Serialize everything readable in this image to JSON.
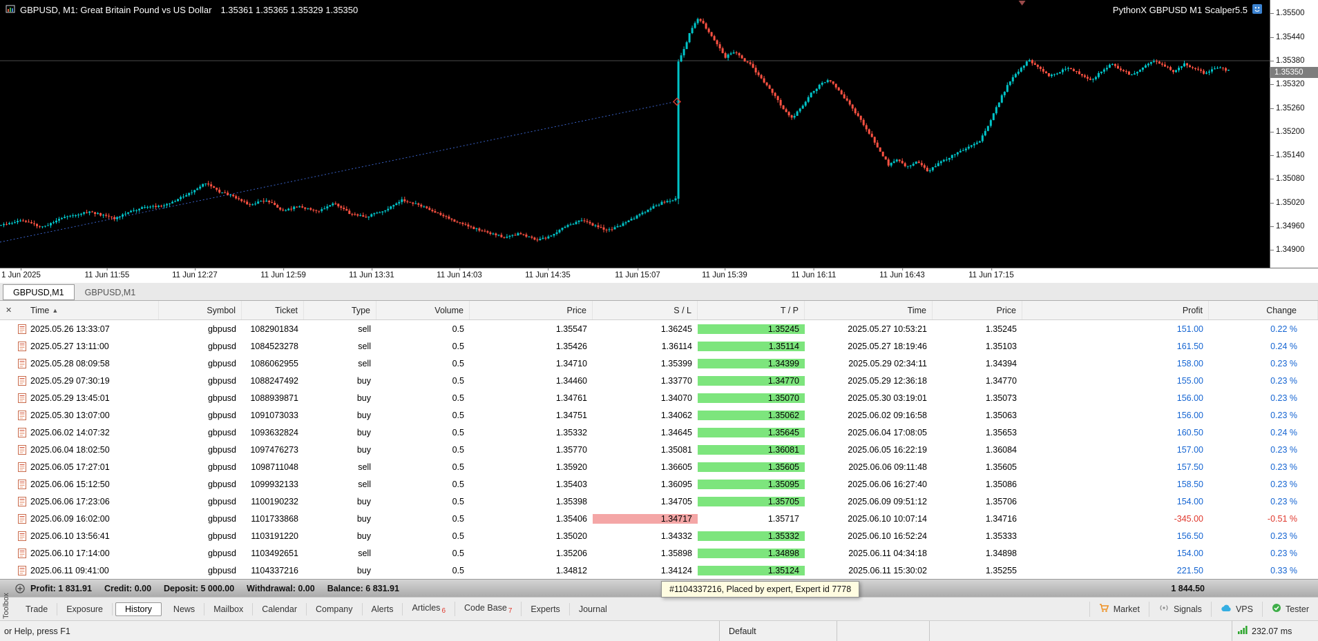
{
  "chart": {
    "title": "GBPUSD, M1:  Great Britain Pound vs US Dollar",
    "ohlc": "1.35361 1.35365 1.35329 1.35350",
    "expert_name": "PythonX GBPUSD M1 Scalper5.5",
    "current_price": "1.35350",
    "colors": {
      "background": "#000000",
      "up": "#00c4c8",
      "down": "#ff5242",
      "trendline": "#3a62c8",
      "hline": "#4a4a4a",
      "badge_bg": "#7d7d7d"
    },
    "chart_data": {
      "type": "candlestick",
      "symbol": "GBPUSD",
      "timeframe": "M1",
      "price_axis_labels": [
        "1.35500",
        "1.35440",
        "1.35380",
        "1.35320",
        "1.35260",
        "1.35200",
        "1.35140",
        "1.35080",
        "1.35020",
        "1.34960",
        "1.34900"
      ],
      "time_axis_labels": [
        {
          "label": "1 Jun 2025",
          "f": 0.0,
          "align": "left"
        },
        {
          "label": "11 Jun 11:55",
          "f": 0.0843
        },
        {
          "label": "11 Jun 12:27",
          "f": 0.1534
        },
        {
          "label": "11 Jun 12:59",
          "f": 0.2231
        },
        {
          "label": "11 Jun 13:31",
          "f": 0.2927
        },
        {
          "label": "11 Jun 14:03",
          "f": 0.3618
        },
        {
          "label": "11 Jun 14:35",
          "f": 0.4314
        },
        {
          "label": "11 Jun 15:07",
          "f": 0.5022
        },
        {
          "label": "11 Jun 15:39",
          "f": 0.5707
        },
        {
          "label": "11 Jun 16:11",
          "f": 0.6409
        },
        {
          "label": "11 Jun 16:43",
          "f": 0.7105
        },
        {
          "label": "11 Jun 17:15",
          "f": 0.7807
        }
      ],
      "price_top": 1.35534,
      "price_bottom": 1.34855,
      "candle_count": 445,
      "noise": 5e-05,
      "wick": 7e-05,
      "seed": 1234567,
      "spike": {
        "t": 0.5515,
        "open": 1.3503,
        "close": 1.35378,
        "low": 1.35016,
        "high": 1.35384
      },
      "trendline": {
        "t1": 0.0,
        "p1": 1.3492,
        "t2": 0.5515,
        "p2": 1.35277
      },
      "marker": {
        "t": 0.5515,
        "p": 1.35276
      },
      "hline_price": 1.3538,
      "shift_marker_f": 0.805,
      "anchors": [
        [
          0.0,
          1.34962
        ],
        [
          0.017,
          1.34976
        ],
        [
          0.034,
          1.34958
        ],
        [
          0.051,
          1.34984
        ],
        [
          0.072,
          1.34997
        ],
        [
          0.092,
          1.3498
        ],
        [
          0.113,
          1.35006
        ],
        [
          0.134,
          1.35014
        ],
        [
          0.152,
          1.3504
        ],
        [
          0.166,
          1.3507
        ],
        [
          0.177,
          1.35048
        ],
        [
          0.19,
          1.35036
        ],
        [
          0.202,
          1.35014
        ],
        [
          0.216,
          1.35027
        ],
        [
          0.229,
          1.35001
        ],
        [
          0.243,
          1.3501
        ],
        [
          0.257,
          1.34997
        ],
        [
          0.271,
          1.35018
        ],
        [
          0.284,
          1.34993
        ],
        [
          0.298,
          1.34984
        ],
        [
          0.312,
          1.35001
        ],
        [
          0.327,
          1.35027
        ],
        [
          0.341,
          1.35014
        ],
        [
          0.355,
          1.34993
        ],
        [
          0.368,
          1.34976
        ],
        [
          0.382,
          1.34958
        ],
        [
          0.396,
          1.34946
        ],
        [
          0.41,
          1.34931
        ],
        [
          0.423,
          1.34942
        ],
        [
          0.437,
          1.34925
        ],
        [
          0.449,
          1.34937
        ],
        [
          0.461,
          1.34962
        ],
        [
          0.473,
          1.34976
        ],
        [
          0.483,
          1.34962
        ],
        [
          0.495,
          1.3495
        ],
        [
          0.505,
          1.34962
        ],
        [
          0.517,
          1.34984
        ],
        [
          0.529,
          1.35006
        ],
        [
          0.54,
          1.35022
        ],
        [
          0.549,
          1.3503
        ],
        [
          0.5505,
          1.35032
        ],
        [
          0.5525,
          1.35378
        ],
        [
          0.556,
          1.35408
        ],
        [
          0.562,
          1.35458
        ],
        [
          0.567,
          1.35488
        ],
        [
          0.573,
          1.3547
        ],
        [
          0.578,
          1.35445
        ],
        [
          0.584,
          1.35417
        ],
        [
          0.59,
          1.35389
        ],
        [
          0.597,
          1.35402
        ],
        [
          0.604,
          1.35385
        ],
        [
          0.611,
          1.35368
        ],
        [
          0.618,
          1.35338
        ],
        [
          0.625,
          1.35312
        ],
        [
          0.632,
          1.35283
        ],
        [
          0.638,
          1.35253
        ],
        [
          0.645,
          1.35236
        ],
        [
          0.652,
          1.35261
        ],
        [
          0.659,
          1.35295
        ],
        [
          0.668,
          1.35321
        ],
        [
          0.675,
          1.35332
        ],
        [
          0.681,
          1.3531
        ],
        [
          0.69,
          1.35274
        ],
        [
          0.699,
          1.35236
        ],
        [
          0.707,
          1.35197
        ],
        [
          0.716,
          1.3515
        ],
        [
          0.723,
          1.35116
        ],
        [
          0.729,
          1.35129
        ],
        [
          0.738,
          1.35112
        ],
        [
          0.747,
          1.35125
        ],
        [
          0.755,
          1.35099
        ],
        [
          0.762,
          1.35116
        ],
        [
          0.771,
          1.35133
        ],
        [
          0.779,
          1.35146
        ],
        [
          0.788,
          1.35159
        ],
        [
          0.797,
          1.35176
        ],
        [
          0.805,
          1.35219
        ],
        [
          0.814,
          1.35283
        ],
        [
          0.822,
          1.35329
        ],
        [
          0.83,
          1.35359
        ],
        [
          0.837,
          1.35381
        ],
        [
          0.845,
          1.35364
        ],
        [
          0.853,
          1.35342
        ],
        [
          0.862,
          1.35351
        ],
        [
          0.87,
          1.35364
        ],
        [
          0.878,
          1.35347
        ],
        [
          0.887,
          1.35329
        ],
        [
          0.896,
          1.35351
        ],
        [
          0.904,
          1.35372
        ],
        [
          0.912,
          1.35359
        ],
        [
          0.921,
          1.35342
        ],
        [
          0.93,
          1.35364
        ],
        [
          0.938,
          1.35381
        ],
        [
          0.947,
          1.35368
        ],
        [
          0.955,
          1.35353
        ],
        [
          0.964,
          1.35372
        ],
        [
          0.973,
          1.35359
        ],
        [
          0.981,
          1.35347
        ],
        [
          0.99,
          1.35364
        ],
        [
          1.0,
          1.35355
        ]
      ]
    }
  },
  "chart_tabs": [
    {
      "label": "GBPUSD,M1",
      "active": true
    },
    {
      "label": "GBPUSD,M1",
      "active": false
    }
  ],
  "toolbox": {
    "caption": "Toolbox",
    "close_label": "✕",
    "columns": [
      {
        "label": "Time",
        "align": "left",
        "sorted": "asc"
      },
      {
        "label": "Symbol"
      },
      {
        "label": "Ticket"
      },
      {
        "label": "Type"
      },
      {
        "label": "Volume"
      },
      {
        "label": "Price"
      },
      {
        "label": "S / L"
      },
      {
        "label": "T / P"
      },
      {
        "label": "Time"
      },
      {
        "label": "Price"
      },
      {
        "label": "Profit"
      },
      {
        "label": "Change",
        "cls": "change"
      }
    ],
    "rows": [
      {
        "time": "2025.05.26 13:33:07",
        "symbol": "gbpusd",
        "ticket": "1082901834",
        "type": "sell",
        "volume": "0.5",
        "price": "1.35547",
        "sl": "1.36245",
        "tp": "1.35245",
        "time2": "2025.05.27 10:53:21",
        "price2": "1.35245",
        "profit": "151.00",
        "change": "0.22 %",
        "hl": "tp",
        "negative": false
      },
      {
        "time": "2025.05.27 13:11:00",
        "symbol": "gbpusd",
        "ticket": "1084523278",
        "type": "sell",
        "volume": "0.5",
        "price": "1.35426",
        "sl": "1.36114",
        "tp": "1.35114",
        "time2": "2025.05.27 18:19:46",
        "price2": "1.35103",
        "profit": "161.50",
        "change": "0.24 %",
        "hl": "tp",
        "negative": false
      },
      {
        "time": "2025.05.28 08:09:58",
        "symbol": "gbpusd",
        "ticket": "1086062955",
        "type": "sell",
        "volume": "0.5",
        "price": "1.34710",
        "sl": "1.35399",
        "tp": "1.34399",
        "time2": "2025.05.29 02:34:11",
        "price2": "1.34394",
        "profit": "158.00",
        "change": "0.23 %",
        "hl": "tp",
        "negative": false
      },
      {
        "time": "2025.05.29 07:30:19",
        "symbol": "gbpusd",
        "ticket": "1088247492",
        "type": "buy",
        "volume": "0.5",
        "price": "1.34460",
        "sl": "1.33770",
        "tp": "1.34770",
        "time2": "2025.05.29 12:36:18",
        "price2": "1.34770",
        "profit": "155.00",
        "change": "0.23 %",
        "hl": "tp",
        "negative": false
      },
      {
        "time": "2025.05.29 13:45:01",
        "symbol": "gbpusd",
        "ticket": "1088939871",
        "type": "buy",
        "volume": "0.5",
        "price": "1.34761",
        "sl": "1.34070",
        "tp": "1.35070",
        "time2": "2025.05.30 03:19:01",
        "price2": "1.35073",
        "profit": "156.00",
        "change": "0.23 %",
        "hl": "tp",
        "negative": false
      },
      {
        "time": "2025.05.30 13:07:00",
        "symbol": "gbpusd",
        "ticket": "1091073033",
        "type": "buy",
        "volume": "0.5",
        "price": "1.34751",
        "sl": "1.34062",
        "tp": "1.35062",
        "time2": "2025.06.02 09:16:58",
        "price2": "1.35063",
        "profit": "156.00",
        "change": "0.23 %",
        "hl": "tp",
        "negative": false
      },
      {
        "time": "2025.06.02 14:07:32",
        "symbol": "gbpusd",
        "ticket": "1093632824",
        "type": "buy",
        "volume": "0.5",
        "price": "1.35332",
        "sl": "1.34645",
        "tp": "1.35645",
        "time2": "2025.06.04 17:08:05",
        "price2": "1.35653",
        "profit": "160.50",
        "change": "0.24 %",
        "hl": "tp",
        "negative": false
      },
      {
        "time": "2025.06.04 18:02:50",
        "symbol": "gbpusd",
        "ticket": "1097476273",
        "type": "buy",
        "volume": "0.5",
        "price": "1.35770",
        "sl": "1.35081",
        "tp": "1.36081",
        "time2": "2025.06.05 16:22:19",
        "price2": "1.36084",
        "profit": "157.00",
        "change": "0.23 %",
        "hl": "tp",
        "negative": false
      },
      {
        "time": "2025.06.05 17:27:01",
        "symbol": "gbpusd",
        "ticket": "1098711048",
        "type": "sell",
        "volume": "0.5",
        "price": "1.35920",
        "sl": "1.36605",
        "tp": "1.35605",
        "time2": "2025.06.06 09:11:48",
        "price2": "1.35605",
        "profit": "157.50",
        "change": "0.23 %",
        "hl": "tp",
        "negative": false
      },
      {
        "time": "2025.06.06 15:12:50",
        "symbol": "gbpusd",
        "ticket": "1099932133",
        "type": "sell",
        "volume": "0.5",
        "price": "1.35403",
        "sl": "1.36095",
        "tp": "1.35095",
        "time2": "2025.06.06 16:27:40",
        "price2": "1.35086",
        "profit": "158.50",
        "change": "0.23 %",
        "hl": "tp",
        "negative": false
      },
      {
        "time": "2025.06.06 17:23:06",
        "symbol": "gbpusd",
        "ticket": "1100190232",
        "type": "buy",
        "volume": "0.5",
        "price": "1.35398",
        "sl": "1.34705",
        "tp": "1.35705",
        "time2": "2025.06.09 09:51:12",
        "price2": "1.35706",
        "profit": "154.00",
        "change": "0.23 %",
        "hl": "tp",
        "negative": false
      },
      {
        "time": "2025.06.09 16:02:00",
        "symbol": "gbpusd",
        "ticket": "1101733868",
        "type": "buy",
        "volume": "0.5",
        "price": "1.35406",
        "sl": "1.34717",
        "tp": "1.35717",
        "time2": "2025.06.10 10:07:14",
        "price2": "1.34716",
        "profit": "-345.00",
        "change": "-0.51 %",
        "hl": "sl",
        "negative": true
      },
      {
        "time": "2025.06.10 13:56:41",
        "symbol": "gbpusd",
        "ticket": "1103191220",
        "type": "buy",
        "volume": "0.5",
        "price": "1.35020",
        "sl": "1.34332",
        "tp": "1.35332",
        "time2": "2025.06.10 16:52:24",
        "price2": "1.35333",
        "profit": "156.50",
        "change": "0.23 %",
        "hl": "tp",
        "negative": false
      },
      {
        "time": "2025.06.10 17:14:00",
        "symbol": "gbpusd",
        "ticket": "1103492651",
        "type": "sell",
        "volume": "0.5",
        "price": "1.35206",
        "sl": "1.35898",
        "tp": "1.34898",
        "time2": "2025.06.11 04:34:18",
        "price2": "1.34898",
        "profit": "154.00",
        "change": "0.23 %",
        "hl": "tp",
        "negative": false
      },
      {
        "time": "2025.06.11 09:41:00",
        "symbol": "gbpusd",
        "ticket": "1104337216",
        "type": "buy",
        "volume": "0.5",
        "price": "1.34812",
        "sl": "1.34124",
        "tp": "1.35124",
        "time2": "2025.06.11 15:30:02",
        "price2": "1.35255",
        "profit": "221.50",
        "change": "0.33 %",
        "hl": "tp",
        "negative": false
      }
    ],
    "summary": {
      "items": [
        {
          "label": "Profit:",
          "value": "1 831.91"
        },
        {
          "label": "Credit:",
          "value": "0.00"
        },
        {
          "label": "Deposit:",
          "value": "5 000.00"
        },
        {
          "label": "Withdrawal:",
          "value": "0.00"
        },
        {
          "label": "Balance:",
          "value": "6 831.91"
        }
      ],
      "total_profit": "1 844.50"
    },
    "tooltip": "#1104337216, Placed by expert, Expert id 7778",
    "tabs": [
      {
        "label": "Trade"
      },
      {
        "label": "Exposure"
      },
      {
        "label": "History",
        "active": true
      },
      {
        "label": "News"
      },
      {
        "label": "Mailbox"
      },
      {
        "label": "Calendar"
      },
      {
        "label": "Company"
      },
      {
        "label": "Alerts"
      },
      {
        "label": "Articles",
        "badge": "6"
      },
      {
        "label": "Code Base",
        "badge": "7"
      },
      {
        "label": "Experts"
      },
      {
        "label": "Journal"
      }
    ],
    "right_items": [
      {
        "label": "Market",
        "icon": "cart-icon"
      },
      {
        "label": "Signals",
        "icon": "signal-icon"
      },
      {
        "label": "VPS",
        "icon": "cloud-icon"
      },
      {
        "label": "Tester",
        "icon": "tester-icon"
      }
    ]
  },
  "status_bar": {
    "help": "or Help, press F1",
    "profile": "Default",
    "latency": "232.07 ms"
  }
}
